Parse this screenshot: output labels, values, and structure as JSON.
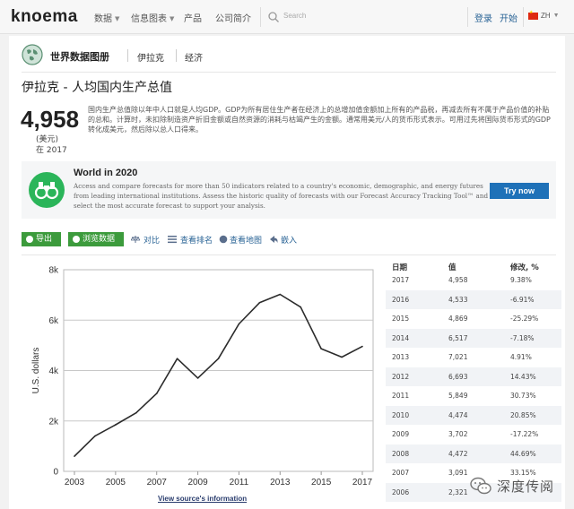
{
  "nav": {
    "logo": "knoema",
    "data": "数据",
    "info_charts": "信息图表",
    "products": "产品",
    "company": "公司简介",
    "search_placeholder": "Search",
    "login": "登录",
    "start": "开始",
    "lang": "ZH"
  },
  "header": {
    "atlas_title": "世界数据图册",
    "breadcrumb_country": "伊拉克",
    "breadcrumb_topic": "经济"
  },
  "indicator": {
    "title": "伊拉克 - 人均国内生产总值",
    "value": "4,958",
    "unit": "(美元)",
    "year": "在 2017",
    "description": "国内生产总值除以年中人口就是人均GDP。GDP为所有居住生产者在经济上的总增加值金额加上所有的产品税，再减去所有不属于产品价值的补贴的总和。计算时，未扣除制造资产折旧金额或自然资源的消耗与枯竭产生的金额。通常用美元/人的货币形式表示。可用过先将国际货币形式的GDP转化成美元，然后除以总人口得来。"
  },
  "banner": {
    "title": "World in 2020",
    "text": "Access and compare forecasts for more than 50 indicators related to a country's economic, demographic, and energy futures from leading international institutions. Assess the historic quality of forecasts with our Forecast Accuracy Tracking Tool™ and select the most accurate forecast to support your analysis.",
    "button": "Try now"
  },
  "actions": {
    "export": "导出",
    "browse": "浏览数据",
    "compare": "对比",
    "ranking": "查看排名",
    "map": "查看地图",
    "embed": "嵌入"
  },
  "table": {
    "headers": [
      "日期",
      "值",
      "修改, %"
    ],
    "rows": [
      {
        "year": "2017",
        "value": "4,958",
        "change": "9.38%"
      },
      {
        "year": "2016",
        "value": "4,533",
        "change": "-6.91%"
      },
      {
        "year": "2015",
        "value": "4,869",
        "change": "-25.29%"
      },
      {
        "year": "2014",
        "value": "6,517",
        "change": "-7.18%"
      },
      {
        "year": "2013",
        "value": "7,021",
        "change": "4.91%"
      },
      {
        "year": "2012",
        "value": "6,693",
        "change": "14.43%"
      },
      {
        "year": "2011",
        "value": "5,849",
        "change": "30.73%"
      },
      {
        "year": "2010",
        "value": "4,474",
        "change": "20.85%"
      },
      {
        "year": "2009",
        "value": "3,702",
        "change": "-17.22%"
      },
      {
        "year": "2008",
        "value": "4,472",
        "change": "44.69%"
      },
      {
        "year": "2007",
        "value": "3,091",
        "change": "33.15%"
      },
      {
        "year": "2006",
        "value": "2,321",
        "change": ""
      }
    ]
  },
  "chart_data": {
    "type": "line",
    "title": "",
    "xlabel": "",
    "ylabel": "U.S. dollars",
    "x": [
      2003,
      2004,
      2005,
      2006,
      2007,
      2008,
      2009,
      2010,
      2011,
      2012,
      2013,
      2014,
      2015,
      2016,
      2017
    ],
    "y_ticks": [
      "0",
      "2k",
      "4k",
      "6k",
      "8k"
    ],
    "x_ticks": [
      "2003",
      "2005",
      "2007",
      "2009",
      "2011",
      "2013",
      "2015",
      "2017"
    ],
    "ylim": [
      0,
      8000
    ],
    "xlim": [
      2003,
      2017
    ],
    "series": [
      {
        "values": [
          600,
          1400,
          1850,
          2321,
          3091,
          4472,
          3702,
          4474,
          5849,
          6693,
          7021,
          6517,
          4869,
          4533,
          4958
        ]
      }
    ],
    "grid": "horizontal",
    "line_color": "#2b2b2b"
  },
  "footer": {
    "source": "View source's information",
    "watermark": "深度传阅"
  }
}
